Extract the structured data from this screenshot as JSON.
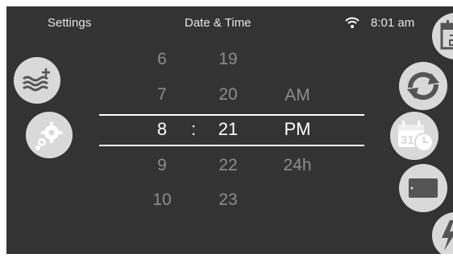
{
  "header": {
    "left_label": "Settings",
    "title": "Date & Time",
    "time": "8:01 am",
    "wifi_icon": "wifi-icon"
  },
  "picker": {
    "hours": [
      "6",
      "7",
      "8",
      "9",
      "10"
    ],
    "minutes": [
      "19",
      "20",
      "21",
      "22",
      "23"
    ],
    "separator": ":",
    "modes": [
      "AM",
      "PM",
      "24h"
    ],
    "selected": {
      "hour": "8",
      "minute": "21",
      "mode": "PM"
    }
  },
  "left_nav": [
    {
      "name": "water-features-icon"
    },
    {
      "name": "settings-gear-icon"
    }
  ],
  "right_nav": [
    {
      "name": "calendar-icon"
    },
    {
      "name": "refresh-cycle-icon"
    },
    {
      "name": "date-time-icon",
      "active_day": "31"
    },
    {
      "name": "display-icon"
    },
    {
      "name": "lightning-icon"
    }
  ],
  "colors": {
    "background": "#333333",
    "button": "#d9d9d9",
    "icon": "#555555",
    "selected_text": "#ffffff",
    "dim_text": "#8c8c8c"
  }
}
